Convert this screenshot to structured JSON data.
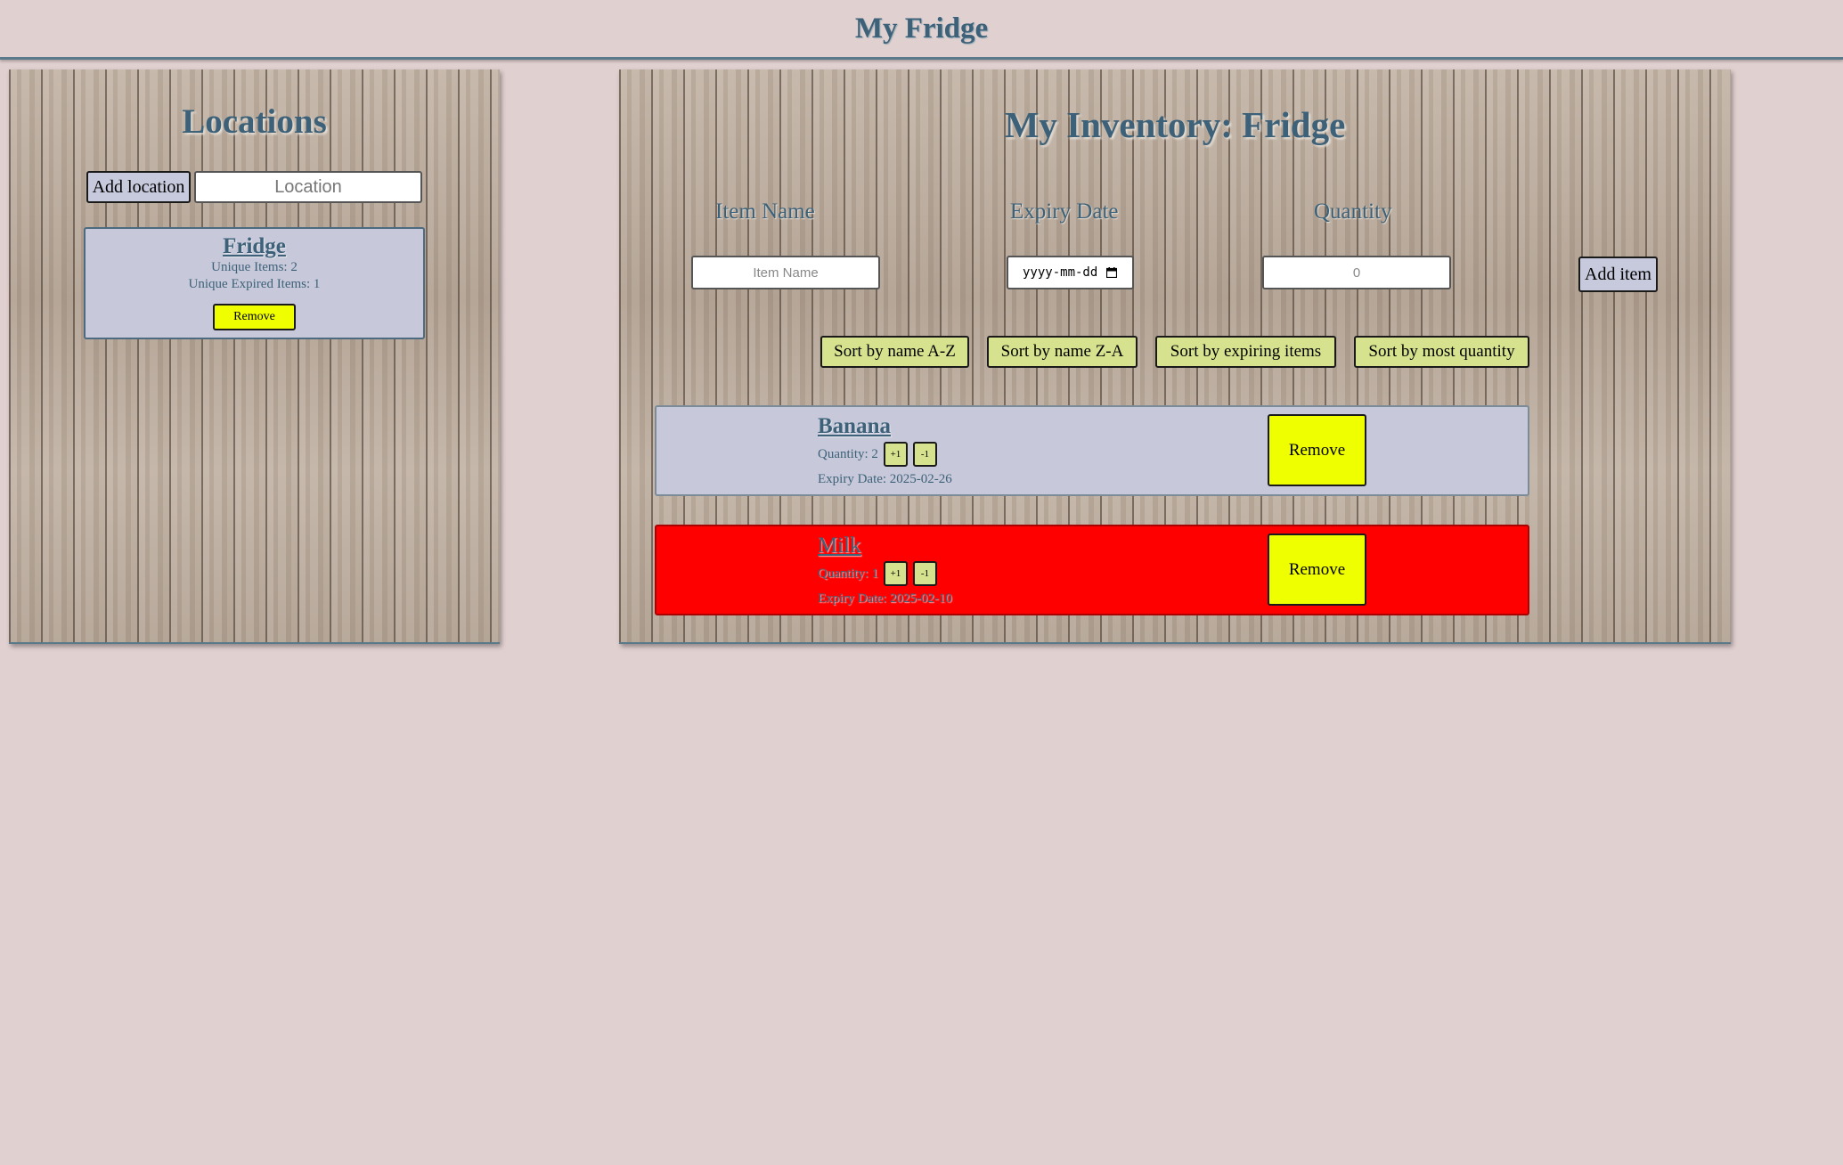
{
  "header": {
    "title": "My Fridge"
  },
  "locations": {
    "title": "Locations",
    "add_button": "Add location",
    "input_placeholder": "Location",
    "cards": [
      {
        "name": "Fridge",
        "unique_items": "Unique Items: 2",
        "unique_expired": "Unique Expired Items: 1",
        "remove_label": "Remove"
      }
    ]
  },
  "inventory": {
    "title": "My Inventory: Fridge",
    "labels": {
      "item_name": "Item Name",
      "expiry_date": "Expiry Date",
      "quantity": "Quantity"
    },
    "inputs": {
      "item_name_placeholder": "Item Name",
      "date_value": "yyyy-mm-dd",
      "quantity_placeholder": "0"
    },
    "add_button": "Add item",
    "sort_buttons": [
      "Sort by name A-Z",
      "Sort by name Z-A",
      "Sort by expiring items",
      "Sort by most quantity"
    ],
    "items": [
      {
        "name": "Banana",
        "quantity": "Quantity: 2",
        "plus": "+1",
        "minus": "-1",
        "expiry": "Expiry Date: 2025-02-26",
        "remove": "Remove",
        "status": "normal"
      },
      {
        "name": "Milk",
        "quantity": "Quantity: 1",
        "plus": "+1",
        "minus": "-1",
        "expiry": "Expiry Date: 2025-02-10",
        "remove": "Remove",
        "status": "expired"
      }
    ]
  },
  "colors": {
    "background": "#e1d0d0",
    "title_text": "#3d6178",
    "card_bg": "#c7c9da",
    "expired_bg": "#ff0000",
    "remove_button": "#f0ff00",
    "sort_button": "#d6e28e"
  },
  "icons": {
    "calendar": "calendar-icon"
  }
}
